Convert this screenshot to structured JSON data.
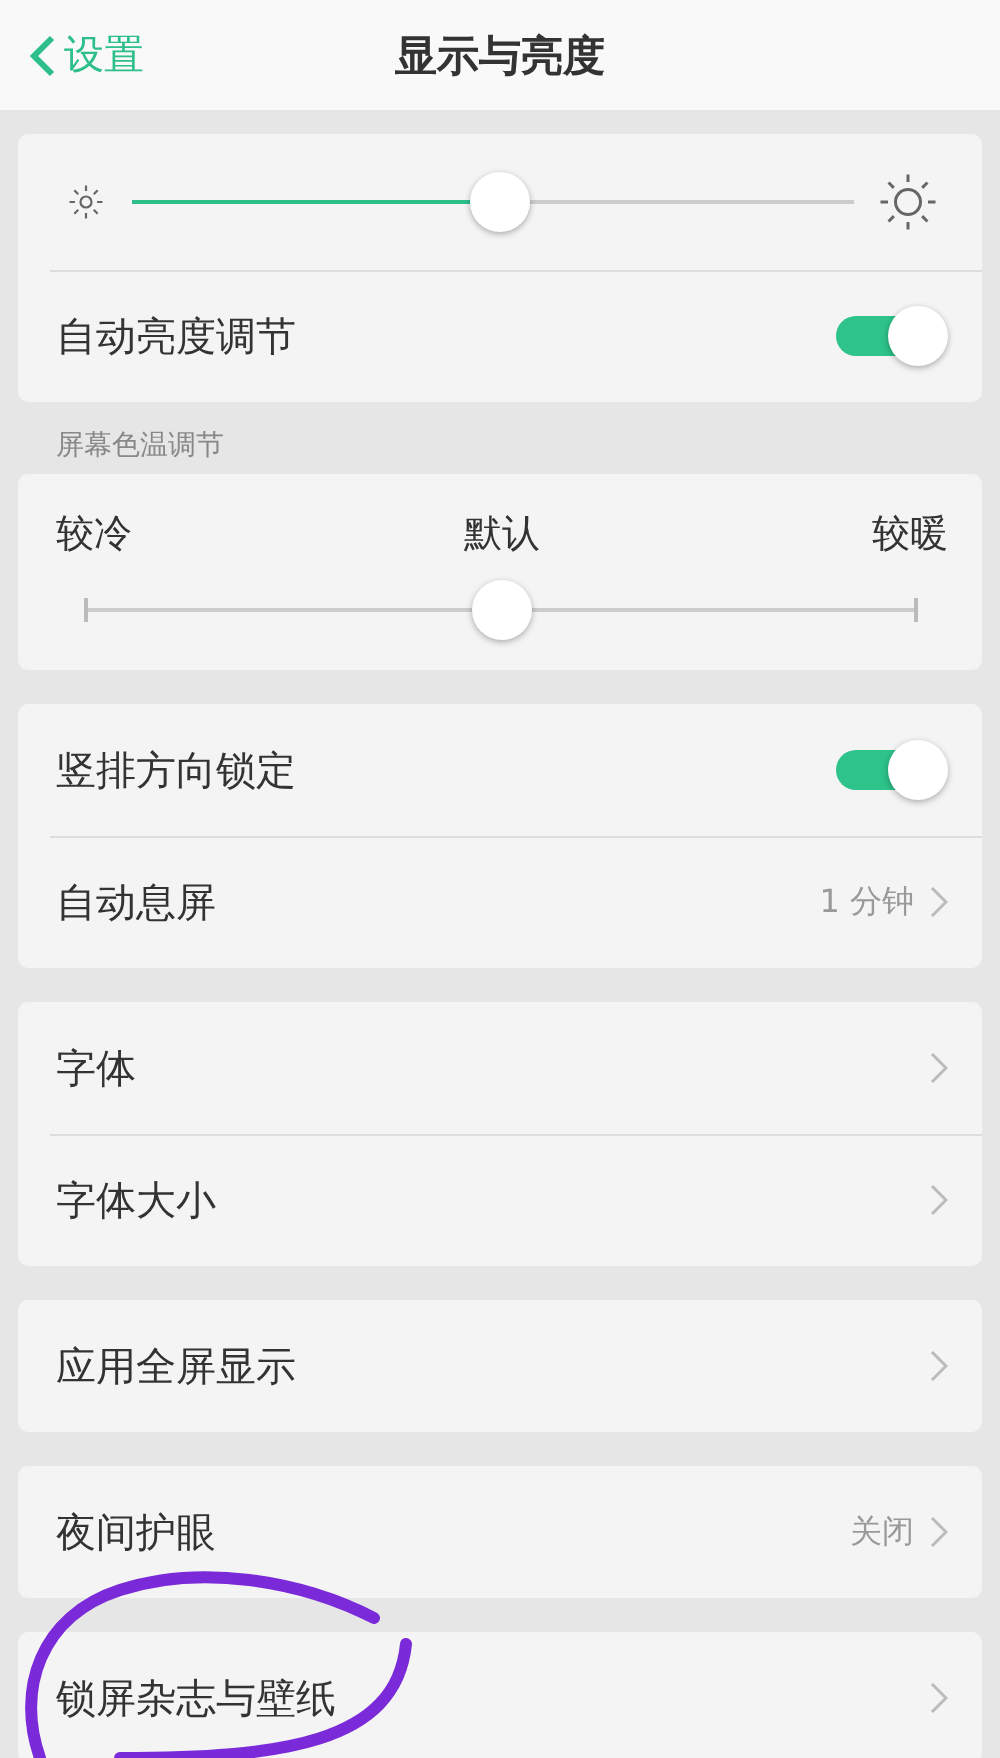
{
  "header": {
    "back_label": "设置",
    "title": "显示与亮度"
  },
  "groups": [
    {
      "items": [
        {
          "kind": "brightness",
          "level": 0.51
        },
        {
          "kind": "toggle",
          "label": "自动亮度调节",
          "on": true
        }
      ]
    },
    {
      "header": "屏幕色温调节",
      "items": [
        {
          "kind": "temperature",
          "labels": [
            "较冷",
            "默认",
            "较暖"
          ],
          "level": 0.5
        }
      ]
    },
    {
      "items": [
        {
          "kind": "toggle",
          "label": "竖排方向锁定",
          "on": true
        },
        {
          "kind": "link",
          "label": "自动息屏",
          "value": "1 分钟"
        }
      ]
    },
    {
      "items": [
        {
          "kind": "link",
          "label": "字体"
        },
        {
          "kind": "link",
          "label": "字体大小"
        }
      ]
    },
    {
      "items": [
        {
          "kind": "link",
          "label": "应用全屏显示"
        }
      ]
    },
    {
      "items": [
        {
          "kind": "link",
          "label": "夜间护眼",
          "value": "关闭"
        }
      ]
    },
    {
      "items": [
        {
          "kind": "link",
          "label": "锁屏杂志与壁纸"
        }
      ]
    }
  ]
}
